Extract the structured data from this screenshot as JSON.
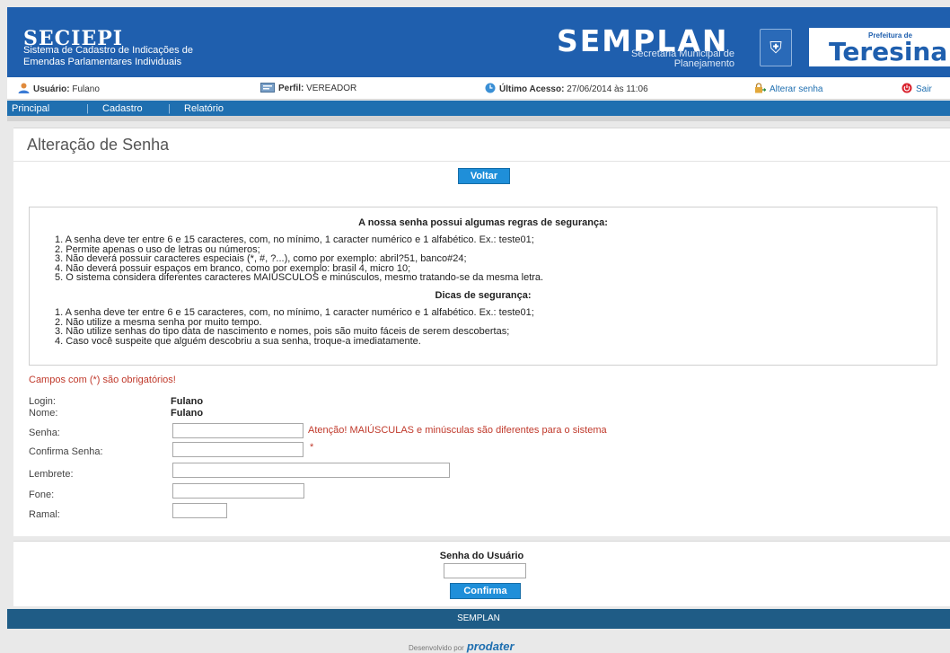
{
  "header": {
    "system_title": "SECIEPI",
    "system_subtitle_line1": "Sistema de Cadastro de Indicações de",
    "system_subtitle_line2": "Emendas Parlamentares Individuais",
    "semplan_name": "SEMPLAN",
    "semplan_sub_line1": "Secretaria Municipal de",
    "semplan_sub_line2": "Planejamento",
    "pref_small": "Prefeitura de",
    "pref_big": "Teresina",
    "brand_color": "#1f5fae"
  },
  "userbar": {
    "user_label": "Usuário:",
    "user_value": "Fulano",
    "profile_label": "Perfil:",
    "profile_value": "VEREADOR",
    "last_access_label": "Último Acesso:",
    "last_access_value": "27/06/2014 às 11:06",
    "change_password": "Alterar senha",
    "logout": "Sair"
  },
  "nav": {
    "items": [
      "Principal",
      "Cadastro",
      "Relatório"
    ],
    "separator": "|"
  },
  "page": {
    "title": "Alteração de Senha",
    "back_button": "Voltar"
  },
  "rules": {
    "title": "A nossa senha possui algumas regras de segurança:",
    "items": [
      "1. A senha deve ter entre 6 e 15 caracteres, com, no mínimo, 1 caracter numérico e 1 alfabético. Ex.: teste01;",
      "2. Permite apenas o uso de letras ou números;",
      "3. Não deverá possuir caracteres especiais (*, #, ?...), como por exemplo: abril?51, banco#24;",
      "4. Não deverá possuir espaços em branco, como por exemplo: brasil 4, micro 10;",
      "5. O sistema considera diferentes caracteres MAIÚSCULOS e minúsculos, mesmo tratando-se da mesma letra."
    ],
    "tips_title": "Dicas de segurança:",
    "tips": [
      "1. A senha deve ter entre 6 e 15 caracteres, com, no mínimo, 1 caracter numérico e 1 alfabético. Ex.: teste01;",
      "2. Não utilize a mesma senha por muito tempo.",
      "3. Não utilize senhas do tipo data de nascimento e nomes, pois são muito fáceis de serem descobertas;",
      "4. Caso você suspeite que alguém descobriu a sua senha, troque-a imediatamente."
    ]
  },
  "form": {
    "required_note": "Campos com (*) são obrigatórios!",
    "login_label": "Login:",
    "login_value": "Fulano",
    "name_label": "Nome:",
    "name_value": "Fulano",
    "password_label": "Senha:",
    "password_value": "",
    "password_warning": "Atenção! MAIÚSCULAS e minúsculas são diferentes para o sistema",
    "confirm_label": "Confirma Senha:",
    "confirm_value": "",
    "required_mark": "*",
    "reminder_label": "Lembrete:",
    "reminder_value": "",
    "phone_label": "Fone:",
    "phone_value": "",
    "extension_label": "Ramal:",
    "extension_value": ""
  },
  "confirm_section": {
    "title": "Senha do Usuário",
    "password_value": "",
    "button": "Confirma"
  },
  "footer": {
    "text": "SEMPLAN",
    "developed_by": "Desenvolvido por",
    "developer_logo": "prodater"
  }
}
